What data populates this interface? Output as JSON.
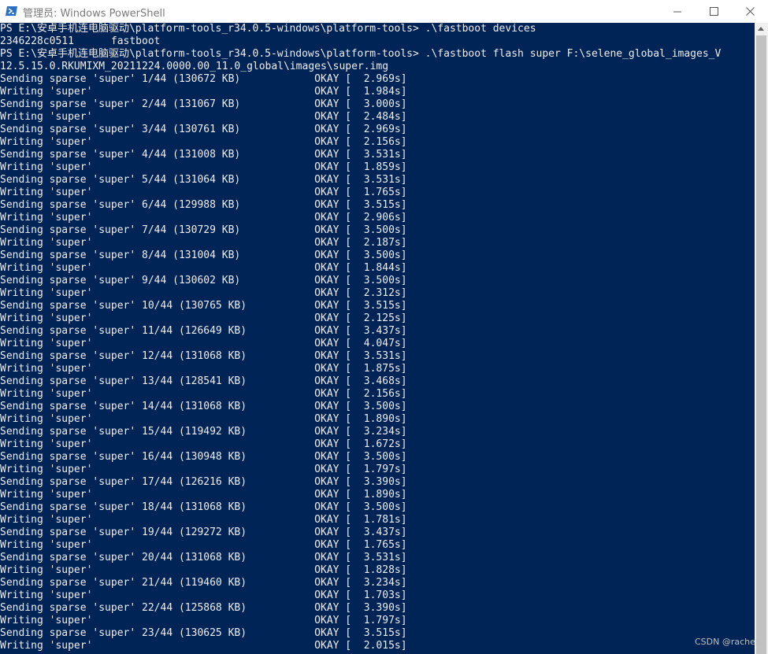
{
  "window": {
    "title": "管理员: Windows PowerShell",
    "minimize_glyph": "—",
    "maximize_glyph": "☐",
    "close_glyph": "✕"
  },
  "console": {
    "lines": [
      "PS E:\\安卓手机连电脑驱动\\platform-tools_r34.0.5-windows\\platform-tools> .\\fastboot devices",
      "2346228c0511      fastboot",
      "PS E:\\安卓手机连电脑驱动\\platform-tools_r34.0.5-windows\\platform-tools> .\\fastboot flash super F:\\selene_global_images_V",
      "12.5.15.0.RKUMIXM_20211224.0000.00_11.0_global\\images\\super.img",
      "Sending sparse 'super' 1/44 (130672 KB)            OKAY [  2.969s]",
      "Writing 'super'                                    OKAY [  1.984s]",
      "Sending sparse 'super' 2/44 (131067 KB)            OKAY [  3.000s]",
      "Writing 'super'                                    OKAY [  2.484s]",
      "Sending sparse 'super' 3/44 (130761 KB)            OKAY [  2.969s]",
      "Writing 'super'                                    OKAY [  2.156s]",
      "Sending sparse 'super' 4/44 (131008 KB)            OKAY [  3.531s]",
      "Writing 'super'                                    OKAY [  1.859s]",
      "Sending sparse 'super' 5/44 (131064 KB)            OKAY [  3.531s]",
      "Writing 'super'                                    OKAY [  1.765s]",
      "Sending sparse 'super' 6/44 (129988 KB)            OKAY [  3.515s]",
      "Writing 'super'                                    OKAY [  2.906s]",
      "Sending sparse 'super' 7/44 (130729 KB)            OKAY [  3.500s]",
      "Writing 'super'                                    OKAY [  2.187s]",
      "Sending sparse 'super' 8/44 (131004 KB)            OKAY [  3.500s]",
      "Writing 'super'                                    OKAY [  1.844s]",
      "Sending sparse 'super' 9/44 (130602 KB)            OKAY [  3.500s]",
      "Writing 'super'                                    OKAY [  2.312s]",
      "Sending sparse 'super' 10/44 (130765 KB)           OKAY [  3.515s]",
      "Writing 'super'                                    OKAY [  2.125s]",
      "Sending sparse 'super' 11/44 (126649 KB)           OKAY [  3.437s]",
      "Writing 'super'                                    OKAY [  4.047s]",
      "Sending sparse 'super' 12/44 (131068 KB)           OKAY [  3.531s]",
      "Writing 'super'                                    OKAY [  1.875s]",
      "Sending sparse 'super' 13/44 (128541 KB)           OKAY [  3.468s]",
      "Writing 'super'                                    OKAY [  2.156s]",
      "Sending sparse 'super' 14/44 (131068 KB)           OKAY [  3.500s]",
      "Writing 'super'                                    OKAY [  1.890s]",
      "Sending sparse 'super' 15/44 (119492 KB)           OKAY [  3.234s]",
      "Writing 'super'                                    OKAY [  1.672s]",
      "Sending sparse 'super' 16/44 (130948 KB)           OKAY [  3.500s]",
      "Writing 'super'                                    OKAY [  1.797s]",
      "Sending sparse 'super' 17/44 (126216 KB)           OKAY [  3.390s]",
      "Writing 'super'                                    OKAY [  1.890s]",
      "Sending sparse 'super' 18/44 (131068 KB)           OKAY [  3.500s]",
      "Writing 'super'                                    OKAY [  1.781s]",
      "Sending sparse 'super' 19/44 (129272 KB)           OKAY [  3.437s]",
      "Writing 'super'                                    OKAY [  1.765s]",
      "Sending sparse 'super' 20/44 (131068 KB)           OKAY [  3.531s]",
      "Writing 'super'                                    OKAY [  1.828s]",
      "Sending sparse 'super' 21/44 (119460 KB)           OKAY [  3.234s]",
      "Writing 'super'                                    OKAY [  1.703s]",
      "Sending sparse 'super' 22/44 (125868 KB)           OKAY [  3.390s]",
      "Writing 'super'                                    OKAY [  1.797s]",
      "Sending sparse 'super' 23/44 (130625 KB)           OKAY [  3.515s]",
      "Writing 'super'                                    OKAY [  2.015s]"
    ]
  },
  "watermark": "CSDN @raches",
  "colors": {
    "console_bg": "#012456",
    "console_text": "#eeedf0",
    "titlebar_bg": "#ffffff"
  },
  "icons": {
    "app": "powershell-icon",
    "minimize": "minimize-icon",
    "maximize": "maximize-icon",
    "close": "close-icon"
  }
}
